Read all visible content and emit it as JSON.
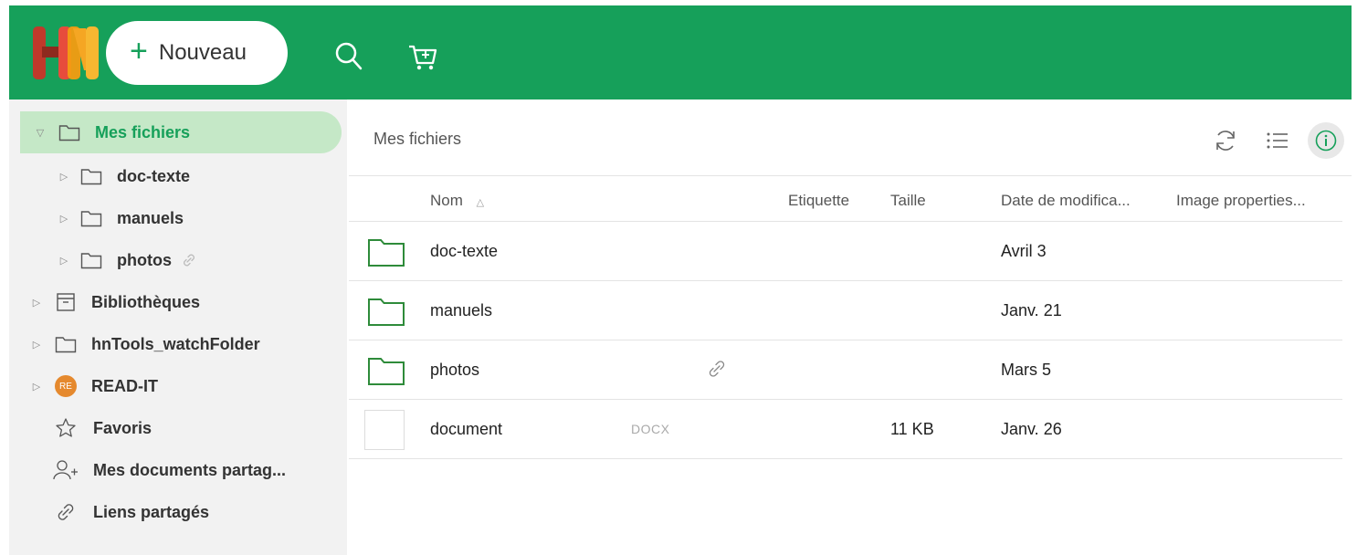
{
  "header": {
    "new_button_label": "Nouveau",
    "brand_color": "#16a05a",
    "icons": [
      "search-icon",
      "cart-icon"
    ]
  },
  "sidebar": {
    "items": [
      {
        "label": "Mes fichiers",
        "icon": "folder-icon",
        "active": true
      },
      {
        "label": "doc-texte",
        "icon": "folder-icon"
      },
      {
        "label": "manuels",
        "icon": "folder-icon"
      },
      {
        "label": "photos",
        "icon": "folder-icon",
        "shared": true
      },
      {
        "label": "Bibliothèques",
        "icon": "archive-icon"
      },
      {
        "label": "hnTools_watchFolder",
        "icon": "folder-icon"
      },
      {
        "label": "READ-IT",
        "icon": "avatar",
        "badge": "RE"
      },
      {
        "label": "Favoris",
        "icon": "star-icon"
      },
      {
        "label": "Mes documents partag...",
        "icon": "add-user-icon"
      },
      {
        "label": "Liens partagés",
        "icon": "link-icon"
      }
    ]
  },
  "main": {
    "breadcrumb": "Mes fichiers",
    "toolbar_icons": [
      "refresh-icon",
      "list-view-icon",
      "info-icon"
    ],
    "columns": {
      "name": "Nom",
      "tag": "Etiquette",
      "size": "Taille",
      "date": "Date de modifica...",
      "image_props": "Image properties..."
    },
    "rows": [
      {
        "name": "doc-texte",
        "type": "folder",
        "date": "Avril 3"
      },
      {
        "name": "manuels",
        "type": "folder",
        "date": "Janv. 21"
      },
      {
        "name": "photos",
        "type": "folder",
        "shared": true,
        "date": "Mars 5"
      },
      {
        "name": "document",
        "type": "file",
        "ext": "DOCX",
        "size": "11 KB",
        "date": "Janv. 26"
      }
    ]
  }
}
